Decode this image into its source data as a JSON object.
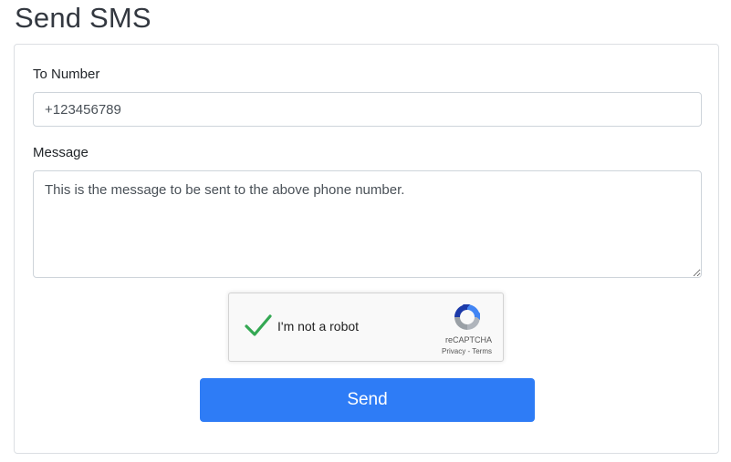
{
  "page": {
    "title": "Send SMS"
  },
  "form": {
    "to_number_label": "To Number",
    "to_number_value": "+123456789",
    "message_label": "Message",
    "message_value": "This is the message to be sent to the above phone number.",
    "send_label": "Send"
  },
  "recaptcha": {
    "label": "I'm not a robot",
    "checked": true,
    "brand": "reCAPTCHA",
    "privacy_label": "Privacy",
    "separator": " - ",
    "terms_label": "Terms",
    "icon": "recaptcha-logo-icon"
  },
  "colors": {
    "primary": "#2e7cf6",
    "check_green": "#34a853",
    "border": "#ced4da"
  }
}
